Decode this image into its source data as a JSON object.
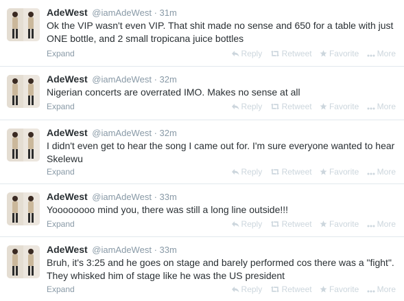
{
  "tweets": [
    {
      "fullname": "AdeWest",
      "username": "@iamAdeWest",
      "separator": "·",
      "time": "31m",
      "text": "Ok the VIP wasn't even VIP. That shit made no sense and 650 for a table with just ONE bottle, and 2 small tropicana juice bottles"
    },
    {
      "fullname": "AdeWest",
      "username": "@iamAdeWest",
      "separator": "·",
      "time": "32m",
      "text": "Nigerian concerts are overrated IMO. Makes no sense at all"
    },
    {
      "fullname": "AdeWest",
      "username": "@iamAdeWest",
      "separator": "·",
      "time": "32m",
      "text": "I didn't even get to hear the song I came out for. I'm sure everyone wanted to hear Skelewu"
    },
    {
      "fullname": "AdeWest",
      "username": "@iamAdeWest",
      "separator": "·",
      "time": "33m",
      "text": "Yoooooooo mind you, there was still a long line outside!!!"
    },
    {
      "fullname": "AdeWest",
      "username": "@iamAdeWest",
      "separator": "·",
      "time": "33m",
      "text": "Bruh, it's 3:25 and he goes on stage and barely performed cos there was a \"fight\". They whisked him of stage like he was the US president"
    }
  ],
  "footer": {
    "expand": "Expand",
    "reply": "Reply",
    "retweet": "Retweet",
    "favorite": "Favorite",
    "more": "More"
  },
  "colors": {
    "text": "#292f33",
    "muted": "#8899a6",
    "action": "#ccd6dd",
    "divider": "#e1e8ed"
  },
  "icons": [
    "reply-icon",
    "retweet-icon",
    "favorite-star-icon",
    "more-dots-icon"
  ]
}
